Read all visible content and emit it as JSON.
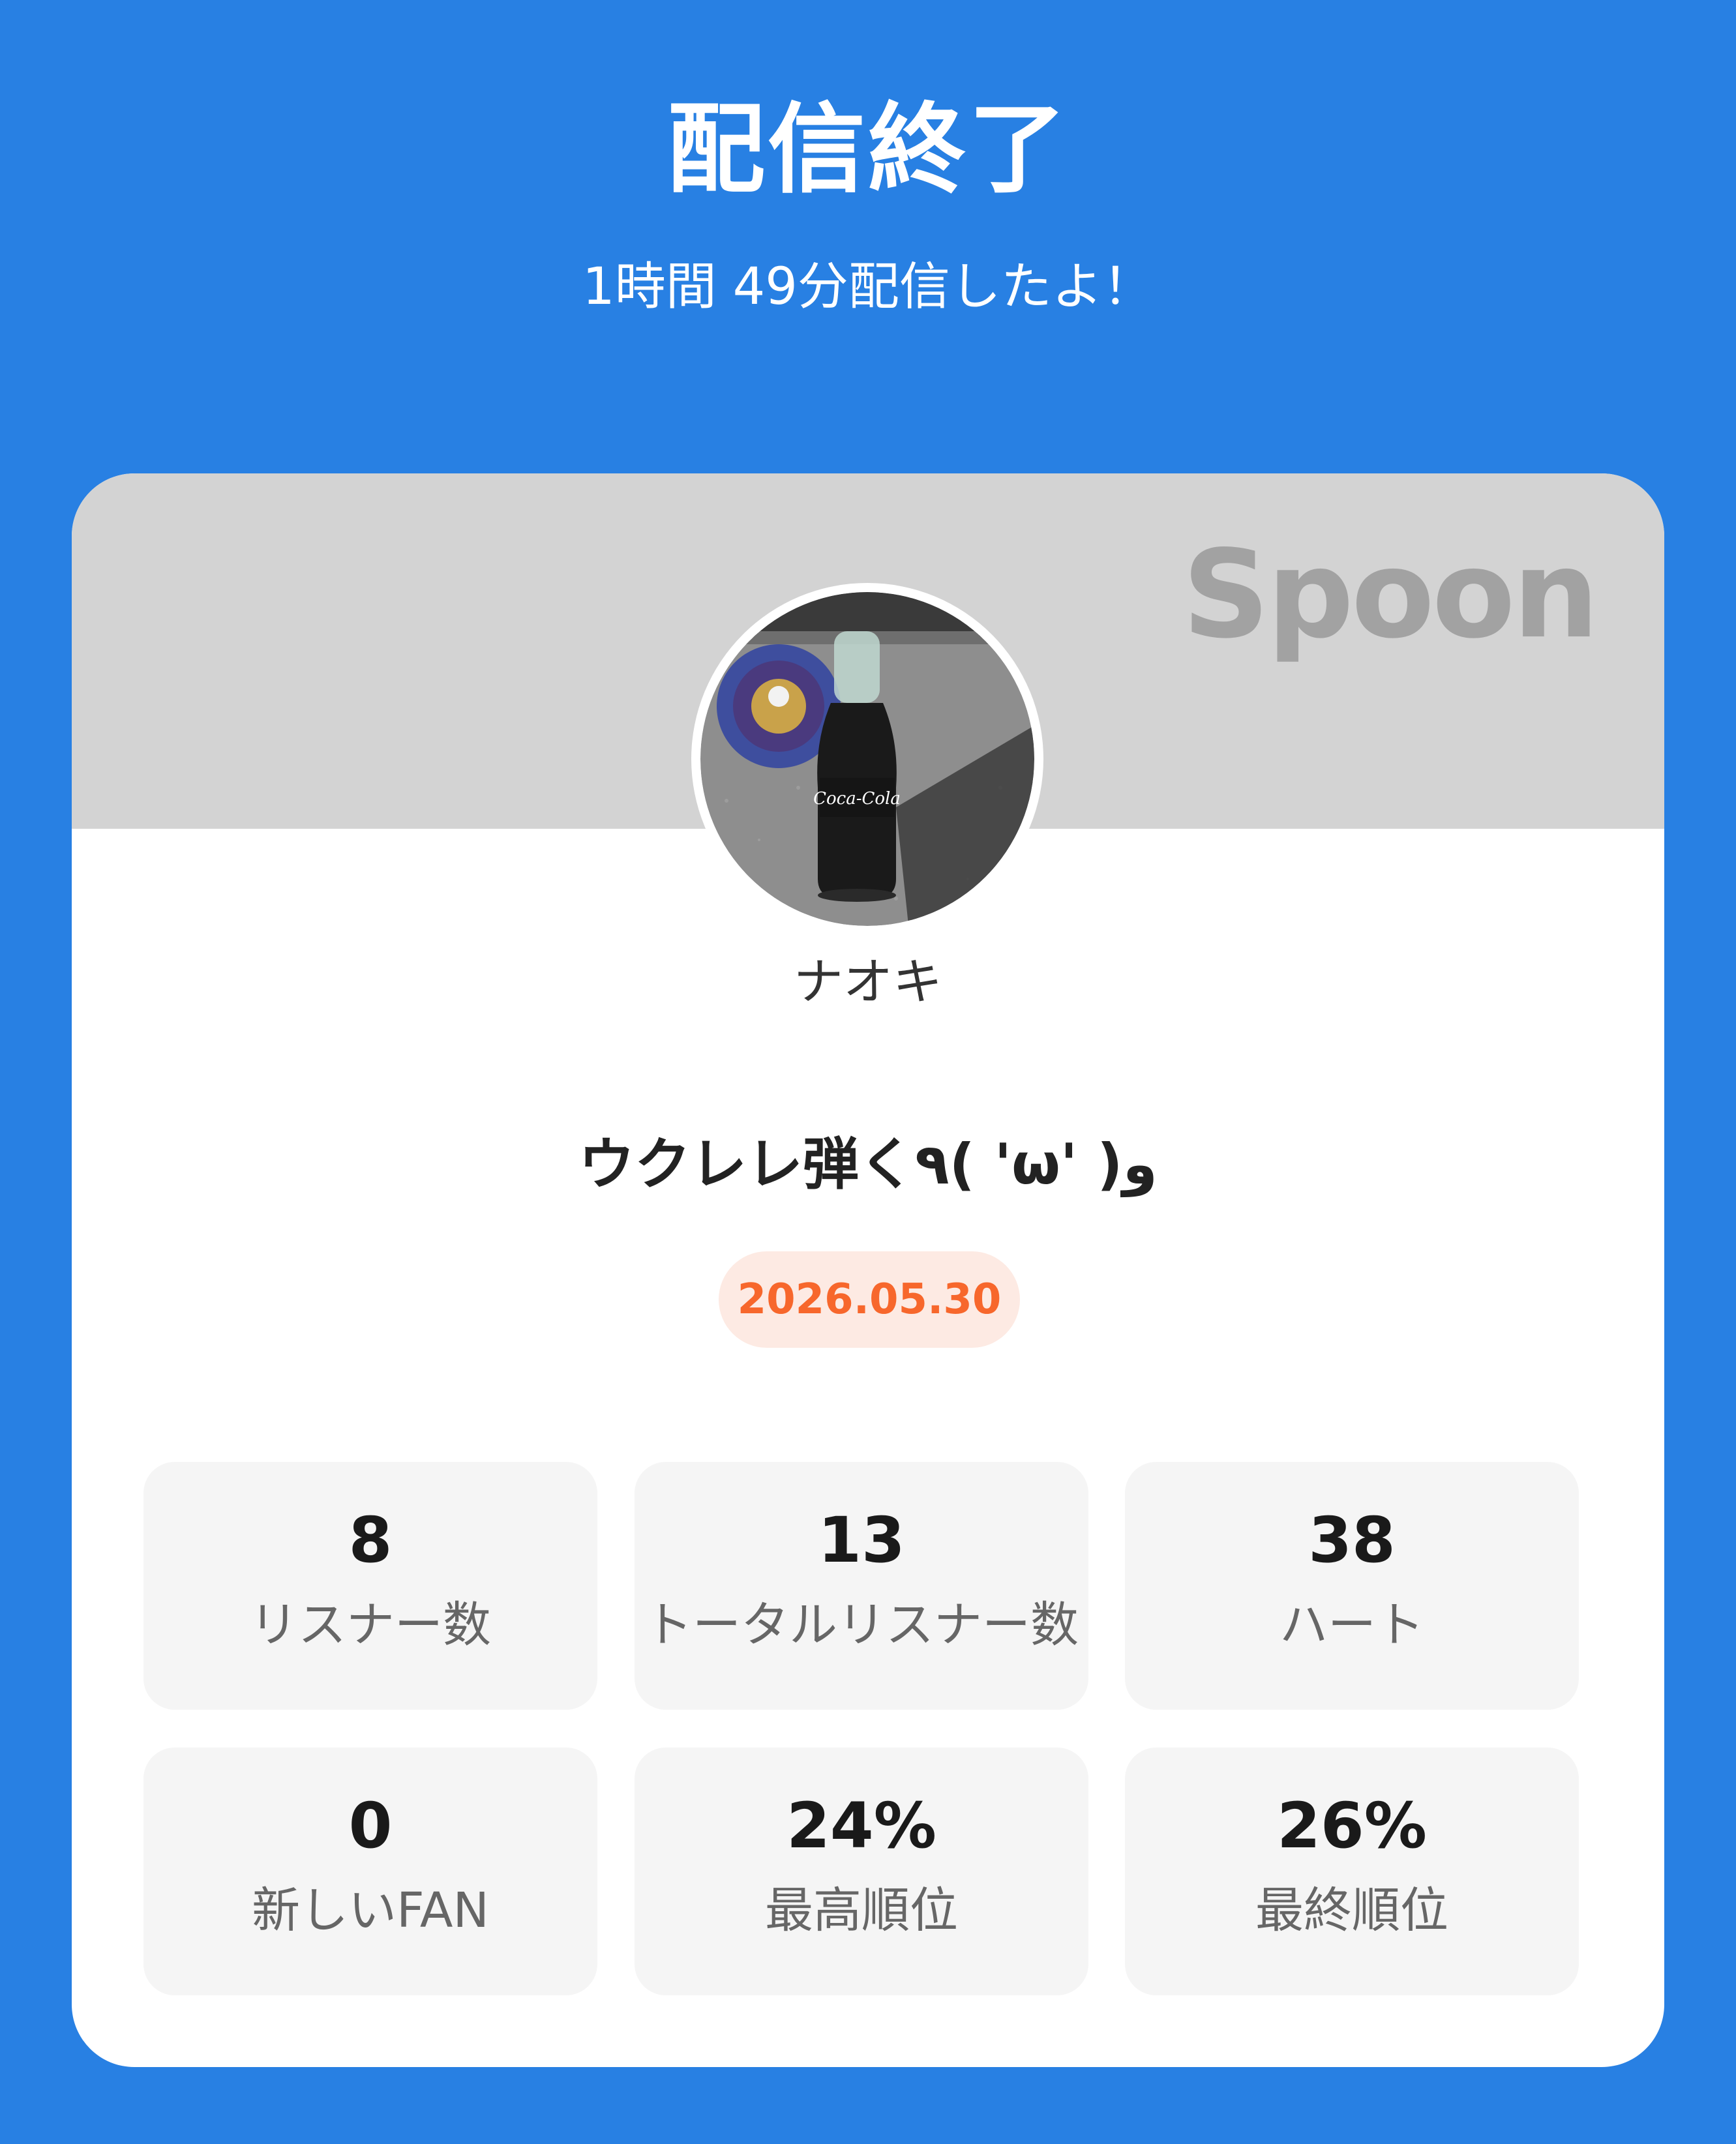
{
  "header": {
    "title": "配信終了",
    "subtitle": "1時間 49分配信したよ！"
  },
  "card": {
    "brand": "Spoon",
    "username": "ナオキ",
    "broadcast_title": "ウクレレ弾く٩( 'ω' )و",
    "date": "2026.05.30",
    "avatar_icon": "profile-photo-cola-bottle"
  },
  "stats": [
    {
      "value": "8",
      "label": "リスナー数"
    },
    {
      "value": "13",
      "label": "トータルリスナー数"
    },
    {
      "value": "38",
      "label": "ハート"
    },
    {
      "value": "0",
      "label": "新しいFAN"
    },
    {
      "value": "24%",
      "label": "最高順位"
    },
    {
      "value": "26%",
      "label": "最終順位"
    }
  ],
  "colors": {
    "background": "#2880E3",
    "banner": "#D3D3D3",
    "date_text": "#F7672C",
    "date_badge": "#FDEAE3"
  }
}
